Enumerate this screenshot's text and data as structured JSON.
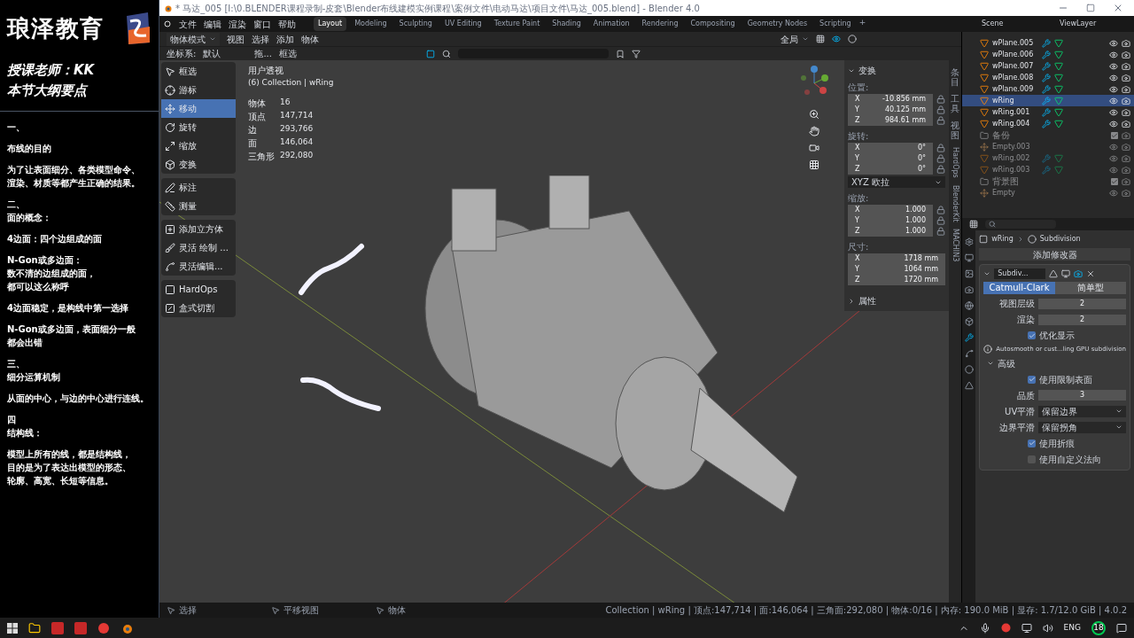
{
  "brand": {
    "name": "琅泽教育",
    "teacher": "授课老师：KK",
    "outline_title": "本节大纲要点"
  },
  "notes": [
    [
      "一、"
    ],
    [
      "布线的目的"
    ],
    [
      "为了让表面细分、各类模型命令、",
      "渲染、材质等都产生正确的结果。"
    ],
    [
      "二、",
      "面的概念："
    ],
    [
      "4边面：四个边组成的面"
    ],
    [
      "N-Gon或多边面：",
      "数不清的边组成的面，",
      "都可以这么称呼"
    ],
    [
      "4边面稳定，是构线中第一选择"
    ],
    [
      "N-Gon或多边面，表面细分一般",
      "都会出错"
    ],
    [
      "三、",
      "细分运算机制"
    ],
    [
      "从面的中心，与边的中心进行连线。"
    ],
    [
      "四",
      "结构线："
    ],
    [
      "模型上所有的线，都是结构线，",
      "目的是为了表达出模型的形态、",
      "轮廓、高宽、长短等信息。"
    ]
  ],
  "window": {
    "title": "* 马达_005 [I:\\0.BLENDER课程录制-皮套\\Blender布线建模实例课程\\案例文件\\电动马达\\项目文件\\马达_005.blend] - Blender 4.0"
  },
  "menu": [
    "文件",
    "编辑",
    "渲染",
    "窗口",
    "帮助"
  ],
  "workspaces": [
    {
      "label": "Layout",
      "selected": true
    },
    {
      "label": "Modeling",
      "selected": false
    },
    {
      "label": "Sculpting",
      "selected": false
    },
    {
      "label": "UV Editing",
      "selected": false
    },
    {
      "label": "Texture Paint",
      "selected": false
    },
    {
      "label": "Shading",
      "selected": false
    },
    {
      "label": "Animation",
      "selected": false
    },
    {
      "label": "Rendering",
      "selected": false
    },
    {
      "label": "Compositing",
      "selected": false
    },
    {
      "label": "Geometry Nodes",
      "selected": false
    },
    {
      "label": "Scripting",
      "selected": false
    }
  ],
  "add_workspace": "+",
  "scene": "Scene",
  "view_layer": "ViewLayer",
  "header": {
    "mode": "物体模式",
    "menus": [
      "视图",
      "选择",
      "添加",
      "物体"
    ],
    "pivot": "全局"
  },
  "tool_header": {
    "orientation_label": "坐标系:",
    "orientation": "默认",
    "drag_label": "拖...",
    "drag": "框选"
  },
  "tools": [
    [
      {
        "label": "框选",
        "selected": false
      },
      {
        "label": "游标",
        "selected": false
      },
      {
        "label": "移动",
        "selected": true
      },
      {
        "label": "旋转",
        "selected": false
      },
      {
        "label": "缩放",
        "selected": false
      },
      {
        "label": "变换",
        "selected": false
      }
    ],
    [
      {
        "label": "标注",
        "selected": false
      },
      {
        "label": "测量",
        "selected": false
      }
    ],
    [
      {
        "label": "添加立方体",
        "selected": false
      },
      {
        "label": "灵活 绘制 ...",
        "selected": false
      },
      {
        "label": "灵活编辑...",
        "selected": false
      }
    ],
    [
      {
        "label": "HardOps",
        "selected": false
      },
      {
        "label": "盒式切割",
        "selected": false
      }
    ]
  ],
  "viewport": {
    "view_name": "用户透视",
    "collection": "(6) Collection | wRing",
    "stats": [
      [
        "物体",
        "16"
      ],
      [
        "顶点",
        "147,714"
      ],
      [
        "边",
        "293,766"
      ],
      [
        "面",
        "146,064"
      ],
      [
        "三角形",
        "292,080"
      ]
    ]
  },
  "n_panel": {
    "title": "变换",
    "groups": [
      {
        "label": "位置:",
        "rows": [
          [
            "X",
            "-10.856 mm"
          ],
          [
            "Y",
            "40.125 mm"
          ],
          [
            "Z",
            "984.61 mm"
          ]
        ],
        "locks": true
      },
      {
        "label": "旋转:",
        "rows": [
          [
            "X",
            "0°"
          ],
          [
            "Y",
            "0°"
          ],
          [
            "Z",
            "0°"
          ]
        ],
        "locks": true,
        "mode": "XYZ 欧拉"
      },
      {
        "label": "缩放:",
        "rows": [
          [
            "X",
            "1.000"
          ],
          [
            "Y",
            "1.000"
          ],
          [
            "Z",
            "1.000"
          ]
        ],
        "locks": true
      },
      {
        "label": "尺寸:",
        "rows": [
          [
            "X",
            "1718 mm"
          ],
          [
            "Y",
            "1064 mm"
          ],
          [
            "Z",
            "1720 mm"
          ]
        ],
        "locks": false
      }
    ],
    "collapsed": "属性"
  },
  "side_tabs": [
    {
      "kind": "cjk",
      "label": "条目"
    },
    {
      "kind": "cjk",
      "label": "工具"
    },
    {
      "kind": "cjk",
      "label": "视图"
    },
    {
      "kind": "latin",
      "label": "HardOps"
    },
    {
      "kind": "latin",
      "label": "BlenderKit"
    },
    {
      "kind": "latin",
      "label": "MACHIN3"
    }
  ],
  "outliner": [
    {
      "kind": "object",
      "name": "wPlane.005",
      "dimmed": false,
      "selected": false
    },
    {
      "kind": "object",
      "name": "wPlane.006",
      "dimmed": false,
      "selected": false
    },
    {
      "kind": "object",
      "name": "wPlane.007",
      "dimmed": false,
      "selected": false
    },
    {
      "kind": "object",
      "name": "wPlane.008",
      "dimmed": false,
      "selected": false
    },
    {
      "kind": "object",
      "name": "wPlane.009",
      "dimmed": false,
      "selected": false
    },
    {
      "kind": "object",
      "name": "wRing",
      "dimmed": false,
      "selected": true
    },
    {
      "kind": "object",
      "name": "wRing.001",
      "dimmed": false,
      "selected": false
    },
    {
      "kind": "object",
      "name": "wRing.004",
      "dimmed": false,
      "selected": false
    },
    {
      "kind": "collection",
      "name": "备份",
      "dimmed": true,
      "selected": false,
      "checked": true
    },
    {
      "kind": "empty",
      "name": "Empty.003",
      "dimmed": true,
      "selected": false
    },
    {
      "kind": "object",
      "name": "wRing.002",
      "dimmed": true,
      "selected": false
    },
    {
      "kind": "object",
      "name": "wRing.003",
      "dimmed": true,
      "selected": false
    },
    {
      "kind": "collection",
      "name": "背景图",
      "dimmed": true,
      "selected": false,
      "checked": true
    },
    {
      "kind": "empty",
      "name": "Empty",
      "dimmed": true,
      "selected": false
    }
  ],
  "properties": {
    "object": "wRing",
    "modifier": "Subdivision",
    "add_modifier": "添加修改器",
    "modifier_name": "Subdiv...",
    "types": [
      {
        "label": "Catmull-Clark",
        "selected": true
      },
      {
        "label": "简单型",
        "selected": false
      }
    ],
    "rows": [
      {
        "kind": "number",
        "label": "视图层级",
        "value": "2"
      },
      {
        "kind": "number",
        "label": "渲染",
        "value": "2"
      },
      {
        "kind": "check",
        "label": "优化显示",
        "checked": true
      },
      {
        "kind": "info",
        "label": "Autosmooth or cust...ling GPU subdivision"
      },
      {
        "kind": "section",
        "label": "高级",
        "expanded": true
      },
      {
        "kind": "check",
        "label": "使用限制表面",
        "checked": true
      },
      {
        "kind": "number",
        "label": "品质",
        "value": "3"
      },
      {
        "kind": "select",
        "label": "UV平滑",
        "value": "保留边界"
      },
      {
        "kind": "select",
        "label": "边界平滑",
        "value": "保留拐角"
      },
      {
        "kind": "check",
        "label": "使用折痕",
        "checked": true
      },
      {
        "kind": "check",
        "label": "使用自定义法向",
        "checked": false
      }
    ]
  },
  "status_bar": {
    "hints": [
      "选择",
      "平移视图",
      "物体"
    ],
    "info": "Collection | wRing | 顶点:147,714 | 面:146,064 | 三角面:292,080 | 物体:0/16 | 内存: 190.0 MiB | 显存: 1.7/12.0 GiB | 4.0.2"
  },
  "taskbar": {
    "language": "ENG",
    "badge": "18"
  }
}
